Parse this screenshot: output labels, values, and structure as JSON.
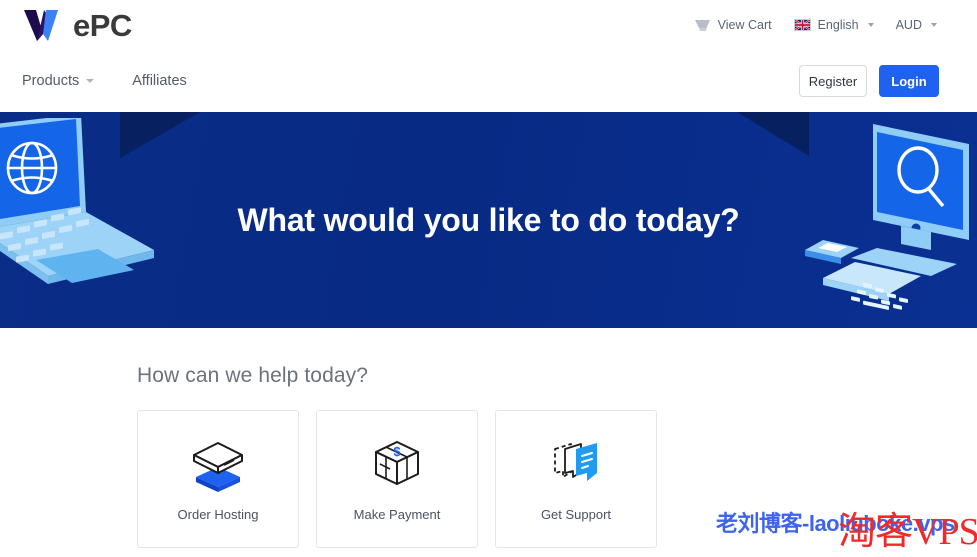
{
  "brand": {
    "logo_word": "ePC",
    "logo_mark_name": "w-logo-mark",
    "logo_dark_color": "#1d0b4e",
    "logo_blue_color": "#3b82f6",
    "word_color": "#3a3a3c"
  },
  "topbar": {
    "cart_label": "View Cart",
    "cart_icon": "shopping-cart-icon",
    "language_label": "English",
    "language_flag": "uk-flag-icon",
    "currency_label": "AUD",
    "caret_icon": "chevron-down-icon"
  },
  "nav": {
    "items": [
      {
        "label": "Products",
        "has_caret": true
      },
      {
        "label": "Affiliates",
        "has_caret": false
      }
    ],
    "register_label": "Register",
    "login_label": "Login",
    "login_color": "#1f62ef"
  },
  "hero": {
    "title": "What would you like to do today?",
    "background_color": "#072a84",
    "corner_color": "#07205f",
    "left_art_name": "isometric-laptop-globe-illustration",
    "right_art_name": "isometric-desktop-search-illustration"
  },
  "main": {
    "section_title": "How can we help today?",
    "cards": [
      {
        "label": "Order Hosting",
        "icon": "stacked-box-icon"
      },
      {
        "label": "Make Payment",
        "icon": "package-dollar-icon"
      },
      {
        "label": "Get Support",
        "icon": "speech-bubbles-icon"
      }
    ]
  },
  "watermarks": {
    "blue_text": "老刘博客-laoliuboke.vps",
    "blue_color": "#3f63ef",
    "red_text": "淘客VPS",
    "red_color": "#ee2a2a"
  }
}
